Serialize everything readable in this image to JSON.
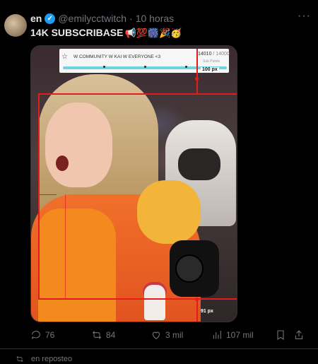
{
  "author": {
    "name": "en",
    "handle": "@emilycctwitch",
    "time": "10 horas"
  },
  "tweet": {
    "text": "14K SUBSCRIBASE",
    "emojis": "📢💯🎆🎉🥳"
  },
  "overlay": {
    "title": "W COMMUNITY W KAI W EVERYONE <3",
    "count": "14010",
    "total": "/ 14000",
    "sub_label": "Sub Points",
    "progress": 1.0,
    "top_measure": "100 px",
    "bottom_measure": "91 px"
  },
  "actions": {
    "replies": "76",
    "reposts": "84",
    "likes": "3 mil",
    "views": "107 mil"
  },
  "next_item": {
    "label": "en reposteo"
  },
  "colors": {
    "accent": "#1d9bf0",
    "guide": "#e11d1d",
    "muted": "#71767b"
  }
}
